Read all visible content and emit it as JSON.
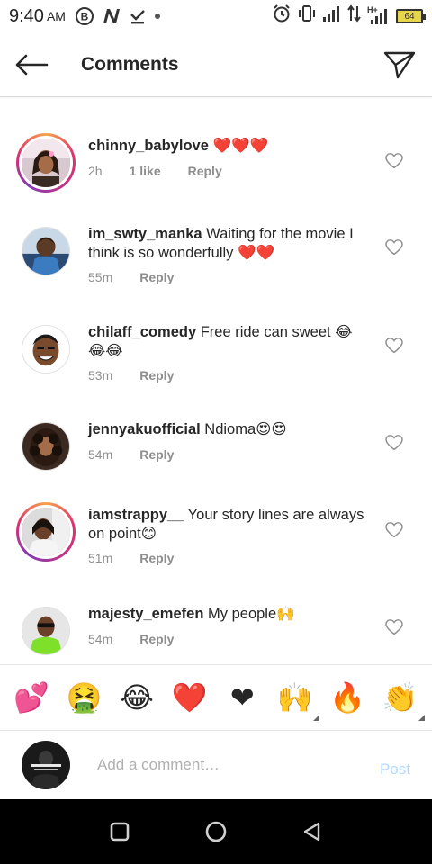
{
  "status_bar": {
    "time": "9:40",
    "ampm": "AM",
    "battery": "64",
    "network_label": "H+"
  },
  "header": {
    "title": "Comments"
  },
  "comments": [
    {
      "username": "chinny_babylove",
      "text": " ❤️❤️❤️",
      "time": "2h",
      "likes": "1 like",
      "reply": "Reply"
    },
    {
      "username": "im_swty_manka",
      "text": " Waiting for the movie I think is so wonderfully ❤️❤️",
      "time": "55m",
      "reply": "Reply"
    },
    {
      "username": "chilaff_comedy",
      "text": " Free ride can sweet 😂😂😂",
      "time": "53m",
      "reply": "Reply"
    },
    {
      "username": "jennyakuofficial",
      "text": " Ndioma😍😍",
      "time": "54m",
      "reply": "Reply"
    },
    {
      "username": "iamstrappy__",
      "text": " Your story lines are always on point😊",
      "time": "51m",
      "reply": "Reply"
    },
    {
      "username": "majesty_emefen",
      "text": " My people🙌",
      "time": "54m",
      "reply": "Reply"
    }
  ],
  "emoji_bar": [
    "💕",
    "🤮",
    "😂",
    "❤️",
    "❤",
    "🙌",
    "🔥",
    "👏"
  ],
  "compose": {
    "placeholder": "Add a comment…",
    "post_label": "Post"
  },
  "colors": {
    "heart_red": "#e0102a",
    "post_disabled": "#b3dbff",
    "meta_gray": "#8e8e8e",
    "ring_start": "#f7a34b",
    "ring_end": "#c13584"
  }
}
